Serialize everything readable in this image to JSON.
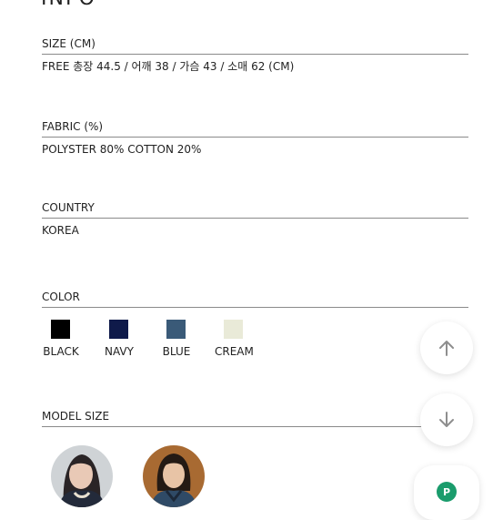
{
  "title": "INFO",
  "sections": {
    "size": {
      "label": "SIZE (CM)",
      "value": "FREE 총장 44.5 / 어깨 38 / 가슴 43 / 소매 62 (CM)"
    },
    "fabric": {
      "label": "FABRIC (%)",
      "value": "POLYSTER 80% COTTON 20%"
    },
    "country": {
      "label": "COUNTRY",
      "value": "KOREA"
    },
    "color": {
      "label": "COLOR"
    },
    "model": {
      "label": "MODEL SIZE"
    }
  },
  "colors": [
    {
      "name": "BLACK",
      "hex": "#000000"
    },
    {
      "name": "NAVY",
      "hex": "#0f1a4a"
    },
    {
      "name": "BLUE",
      "hex": "#3a5a78"
    },
    {
      "name": "CREAM",
      "hex": "#e9ead8"
    }
  ],
  "fabs": {
    "up": "scroll-up",
    "down": "scroll-down",
    "badge": "P"
  },
  "badge_color": "#1a9c6c"
}
